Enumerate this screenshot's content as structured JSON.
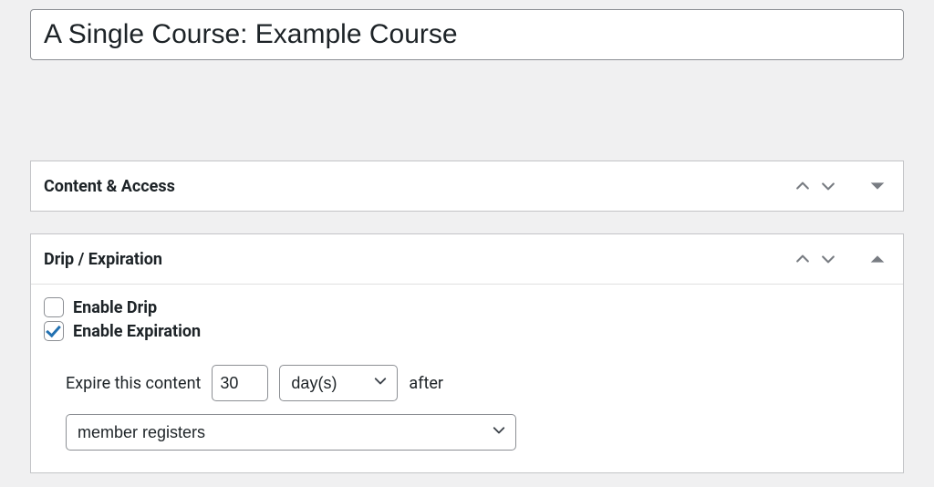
{
  "title_value": "A Single Course: Example Course",
  "panels": {
    "content_access": {
      "title": "Content & Access"
    },
    "drip_expiration": {
      "title": "Drip / Expiration",
      "enable_drip_label": "Enable Drip",
      "enable_drip_checked": false,
      "enable_expiration_label": "Enable Expiration",
      "enable_expiration_checked": true,
      "expire_label": "Expire this content",
      "duration_value": "30",
      "unit_selected": "day(s)",
      "after_label": "after",
      "trigger_selected": "member registers"
    }
  }
}
